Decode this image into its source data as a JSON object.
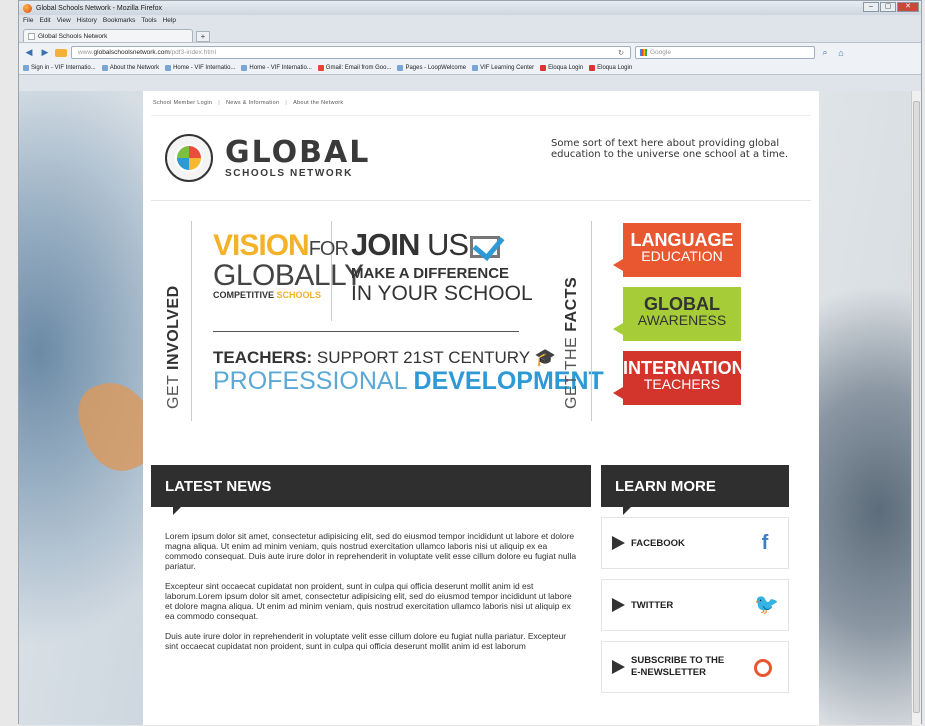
{
  "window": {
    "title": "Global Schools Network - Mozilla Firefox",
    "controls": [
      "–",
      "▢",
      "✕"
    ]
  },
  "menu": [
    "File",
    "Edit",
    "View",
    "History",
    "Bookmarks",
    "Tools",
    "Help"
  ],
  "tabs": [
    {
      "label": "Global Schools Network"
    }
  ],
  "newtab": "+",
  "nav": {
    "url_prefix": "www.",
    "url_domain": "globalschoolsnetwork.com",
    "url_path": "/pdf3-index.html",
    "search_placeholder": "Google"
  },
  "bookmarks": [
    "Sign in - VIF Internatio...",
    "About the Network",
    "Home - VIF Internatio...",
    "Home - VIF Internatio...",
    "Gmail: Email from Goo...",
    "Pages - LoopWelcome",
    "VIF Learning Center",
    "Eloqua Login",
    "Eloqua Login"
  ],
  "page": {
    "topnav": [
      "School Member Login",
      "News & Information",
      "About the Network"
    ],
    "topnav_sep": "|",
    "logo_big": "GLOBAL",
    "logo_small": "SCHOOLS NETWORK",
    "tagline": "Some sort of text here about providing global education to the universe one school at a time.",
    "get_involved_a": "GET ",
    "get_involved_b": "INVOLVED",
    "get_facts_a": "GET THE ",
    "get_facts_b": "FACTS",
    "vision_a": "VISION",
    "vision_b": "FOR",
    "vision_c": "GLOBALLY",
    "vision_d": "COMPETITIVE ",
    "vision_e": "SCHOOLS",
    "join_a": "JOIN",
    "join_b": " US",
    "join_c": "MAKE A DIFFERENCE",
    "join_d": "IN YOUR SCHOOL",
    "teach_a": "TEACHERS:",
    "teach_b": " SUPPORT 21ST CENTURY",
    "teach_c": "PROFESSIONAL ",
    "teach_d": "DEVELOPMENT",
    "facts": [
      {
        "title": "LANGUAGE",
        "sub": "EDUCATION"
      },
      {
        "title": "GLOBAL",
        "sub": "AWARENESS"
      },
      {
        "title": "INTERNATIONAL",
        "sub": "TEACHERS"
      }
    ],
    "news_title": "LATEST NEWS",
    "news_paragraphs": [
      "Lorem ipsum dolor sit amet, consectetur adipisicing elit, sed do eiusmod tempor incididunt ut labore et dolore magna aliqua. Ut enim ad minim veniam, quis nostrud exercitation ullamco laboris nisi ut aliquip ex ea commodo consequat. Duis aute irure dolor in reprehenderit in voluptate velit esse cillum dolore eu fugiat nulla pariatur.",
      "Excepteur sint occaecat cupidatat non proident, sunt in culpa qui officia deserunt mollit anim id est laborum.Lorem ipsum dolor sit amet, consectetur adipisicing elit, sed do eiusmod tempor incididunt ut labore et dolore magna aliqua. Ut enim ad minim veniam, quis nostrud exercitation ullamco laboris nisi ut aliquip ex ea commodo consequat.",
      "Duis aute irure dolor in reprehenderit in voluptate velit esse cillum dolore eu fugiat nulla pariatur. Excepteur sint occaecat cupidatat non proident, sunt in culpa qui officia deserunt mollit anim id est laborum"
    ],
    "learn_title": "LEARN MORE",
    "learn_items": [
      {
        "label": "FACEBOOK",
        "icon": "facebook-icon",
        "glyph": "f"
      },
      {
        "label": "TWITTER",
        "icon": "twitter-icon",
        "glyph": "🐦"
      },
      {
        "label_a": "SUBSCRIBE TO THE",
        "label_b": "E-NEWSLETTER",
        "icon": "newsletter-icon",
        "glyph": "o"
      }
    ]
  },
  "colors": {
    "orange": "#e8572f",
    "green": "#a6cd38",
    "red": "#d3352c",
    "yellow": "#f3b229",
    "blue": "#2d9ad6",
    "dark": "#2f2f2f"
  }
}
